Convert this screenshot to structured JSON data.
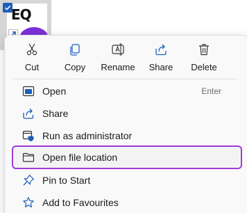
{
  "desktop_icon": {
    "thumbnail_text": "EQ",
    "selected": true
  },
  "quick_actions": [
    {
      "label": "Cut",
      "icon": "scissors-icon"
    },
    {
      "label": "Copy",
      "icon": "copy-icon"
    },
    {
      "label": "Rename",
      "icon": "rename-icon"
    },
    {
      "label": "Share",
      "icon": "share-icon"
    },
    {
      "label": "Delete",
      "icon": "trash-icon"
    }
  ],
  "menu_items": [
    {
      "label": "Open",
      "shortcut": "Enter",
      "icon": "open-window-icon"
    },
    {
      "label": "Share",
      "icon": "share-icon"
    },
    {
      "label": "Run as administrator",
      "icon": "shield-window-icon"
    },
    {
      "label": "Open file location",
      "icon": "folder-icon",
      "highlighted": true
    },
    {
      "label": "Pin to Start",
      "icon": "pin-icon"
    },
    {
      "label": "Add to Favourites",
      "icon": "star-icon"
    }
  ],
  "colors": {
    "highlight_border": "#a03ad6",
    "accent_blue": "#1d5fb8",
    "thumbnail_purple": "#7b2fd6"
  }
}
